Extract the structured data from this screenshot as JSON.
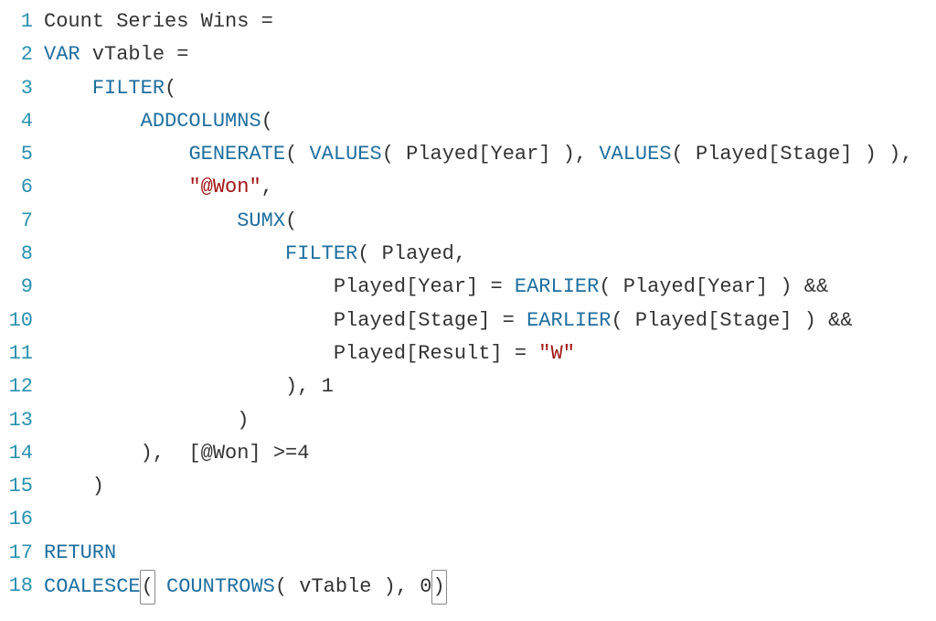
{
  "code": {
    "lineNumbers": [
      "1",
      "2",
      "3",
      "4",
      "5",
      "6",
      "7",
      "8",
      "9",
      "10",
      "11",
      "12",
      "13",
      "14",
      "15",
      "16",
      "17",
      "18"
    ],
    "lines": [
      [
        {
          "t": "Count Series Wins ",
          "c": "plain"
        },
        {
          "t": "=",
          "c": "punct"
        }
      ],
      [
        {
          "t": "VAR",
          "c": "kw"
        },
        {
          "t": " vTable ",
          "c": "plain"
        },
        {
          "t": "=",
          "c": "punct"
        }
      ],
      [
        {
          "t": "    ",
          "c": "plain"
        },
        {
          "t": "FILTER",
          "c": "fn"
        },
        {
          "t": "(",
          "c": "punct"
        }
      ],
      [
        {
          "t": "        ",
          "c": "plain"
        },
        {
          "t": "ADDCOLUMNS",
          "c": "fn"
        },
        {
          "t": "(",
          "c": "punct"
        }
      ],
      [
        {
          "t": "            ",
          "c": "plain"
        },
        {
          "t": "GENERATE",
          "c": "fn"
        },
        {
          "t": "( ",
          "c": "punct"
        },
        {
          "t": "VALUES",
          "c": "fn"
        },
        {
          "t": "( Played[Year] ), ",
          "c": "plain"
        },
        {
          "t": "VALUES",
          "c": "fn"
        },
        {
          "t": "( Played[Stage] ) ),",
          "c": "plain"
        }
      ],
      [
        {
          "t": "            ",
          "c": "plain"
        },
        {
          "t": "\"@Won\"",
          "c": "str"
        },
        {
          "t": ",",
          "c": "punct"
        }
      ],
      [
        {
          "t": "                ",
          "c": "plain"
        },
        {
          "t": "SUMX",
          "c": "fn"
        },
        {
          "t": "(",
          "c": "punct"
        }
      ],
      [
        {
          "t": "                    ",
          "c": "plain"
        },
        {
          "t": "FILTER",
          "c": "fn"
        },
        {
          "t": "( Played,",
          "c": "plain"
        }
      ],
      [
        {
          "t": "                        Played[Year] = ",
          "c": "plain"
        },
        {
          "t": "EARLIER",
          "c": "fn"
        },
        {
          "t": "( Played[Year] ) &&",
          "c": "plain"
        }
      ],
      [
        {
          "t": "                        Played[Stage] = ",
          "c": "plain"
        },
        {
          "t": "EARLIER",
          "c": "fn"
        },
        {
          "t": "( Played[Stage] ) &&",
          "c": "plain"
        }
      ],
      [
        {
          "t": "                        Played[Result] = ",
          "c": "plain"
        },
        {
          "t": "\"W\"",
          "c": "str"
        }
      ],
      [
        {
          "t": "                    ), ",
          "c": "plain"
        },
        {
          "t": "1",
          "c": "num"
        }
      ],
      [
        {
          "t": "                )",
          "c": "plain"
        }
      ],
      [
        {
          "t": "        ),  [@Won] >=",
          "c": "plain"
        },
        {
          "t": "4",
          "c": "num"
        }
      ],
      [
        {
          "t": "    )",
          "c": "plain"
        }
      ],
      [
        {
          "t": " ",
          "c": "plain"
        }
      ],
      [
        {
          "t": "RETURN",
          "c": "kw"
        }
      ],
      [
        {
          "t": "COALESCE",
          "c": "fn"
        },
        {
          "t": "(",
          "c": "punct",
          "box": true
        },
        {
          "t": " ",
          "c": "plain"
        },
        {
          "t": "COUNTROWS",
          "c": "fn"
        },
        {
          "t": "( vTable ), ",
          "c": "plain"
        },
        {
          "t": "0",
          "c": "num"
        },
        {
          "t": ")",
          "c": "punct",
          "box": true
        }
      ]
    ]
  }
}
